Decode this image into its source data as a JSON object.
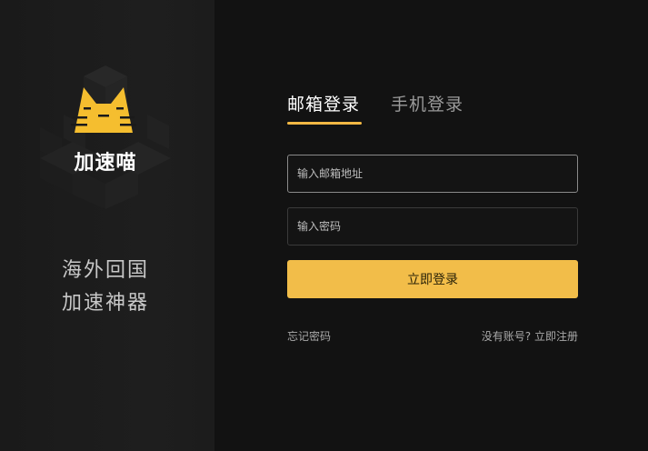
{
  "brand": {
    "name": "加速喵",
    "slogan_line1": "海外回国",
    "slogan_line2": "加速神器",
    "accent_color": "#f2bd49"
  },
  "tabs": [
    {
      "label": "邮箱登录",
      "active": true
    },
    {
      "label": "手机登录",
      "active": false
    }
  ],
  "form": {
    "email_placeholder": "输入邮箱地址",
    "password_placeholder": "输入密码",
    "submit_label": "立即登录"
  },
  "footer": {
    "forgot_label": "忘记密码",
    "no_account_label": "没有账号?",
    "register_label": "立即注册"
  },
  "icons": {
    "logo": "cat-logo-icon"
  }
}
